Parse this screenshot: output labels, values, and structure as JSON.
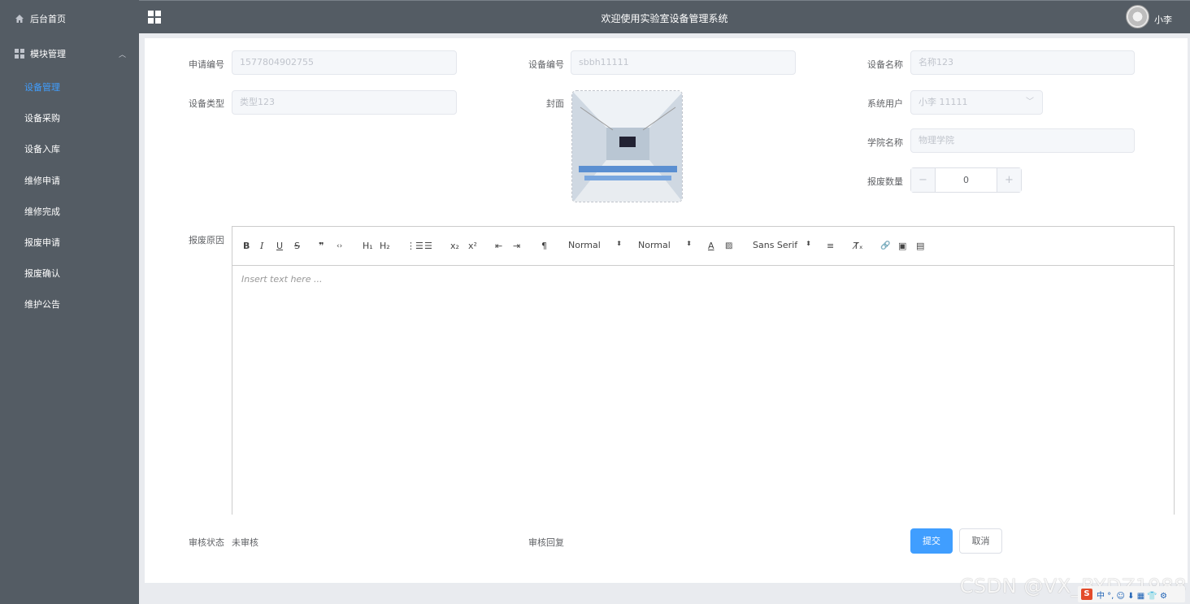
{
  "header": {
    "title": "欢迎使用实验室设备管理系统",
    "user_name": "小李"
  },
  "sidebar": {
    "home": "后台首页",
    "module": "模块管理",
    "items": [
      "设备管理",
      "设备采购",
      "设备入库",
      "维修申请",
      "维修完成",
      "报废申请",
      "报废确认",
      "维护公告"
    ],
    "active_index": 0
  },
  "form": {
    "apply_no_label": "申请编号",
    "apply_no_value": "1577804902755",
    "device_no_label": "设备编号",
    "device_no_value": "sbbh11111",
    "device_name_label": "设备名称",
    "device_name_value": "名称123",
    "device_type_label": "设备类型",
    "device_type_value": "类型123",
    "cover_label": "封面",
    "system_user_label": "系统用户",
    "system_user_value": "小李 11111",
    "college_label": "学院名称",
    "college_value": "物理学院",
    "scrap_qty_label": "报废数量",
    "scrap_qty_value": "0",
    "minus": "−",
    "plus": "+",
    "reason_label": "报废原因",
    "editor_placeholder": "Insert text here ...",
    "audit_status_label": "审核状态",
    "audit_status_value": "未审核",
    "audit_reply_label": "审核回复",
    "submit": "提交",
    "cancel": "取消"
  },
  "toolbar": {
    "bold": "B",
    "italic": "I",
    "underline": "U",
    "strike": "S",
    "quote": "❞",
    "code": "‹›",
    "h1": "H₁",
    "h2": "H₂",
    "ordered": "⋮☰",
    "bullet": "☰",
    "sub": "x₂",
    "sup": "x²",
    "outdent": "⇤",
    "indent": "⇥",
    "rtl": "¶",
    "size_picker": "Normal",
    "header_picker": "Normal",
    "font_picker": "Sans Serif",
    "align": "≡",
    "clean": "T̸ₓ",
    "link": "🔗",
    "image": "▣",
    "video": "▤",
    "picker_arrow": "⬍"
  },
  "watermark": "CSDN @VX_BYDZ1988",
  "ime": {
    "logo": "S",
    "text": "中 °, ☺ ⬇ ▦ 👕 ⚙"
  },
  "colors": {
    "sidebar": "#545c64",
    "active": "#409eff",
    "panel": "#ffffff"
  }
}
